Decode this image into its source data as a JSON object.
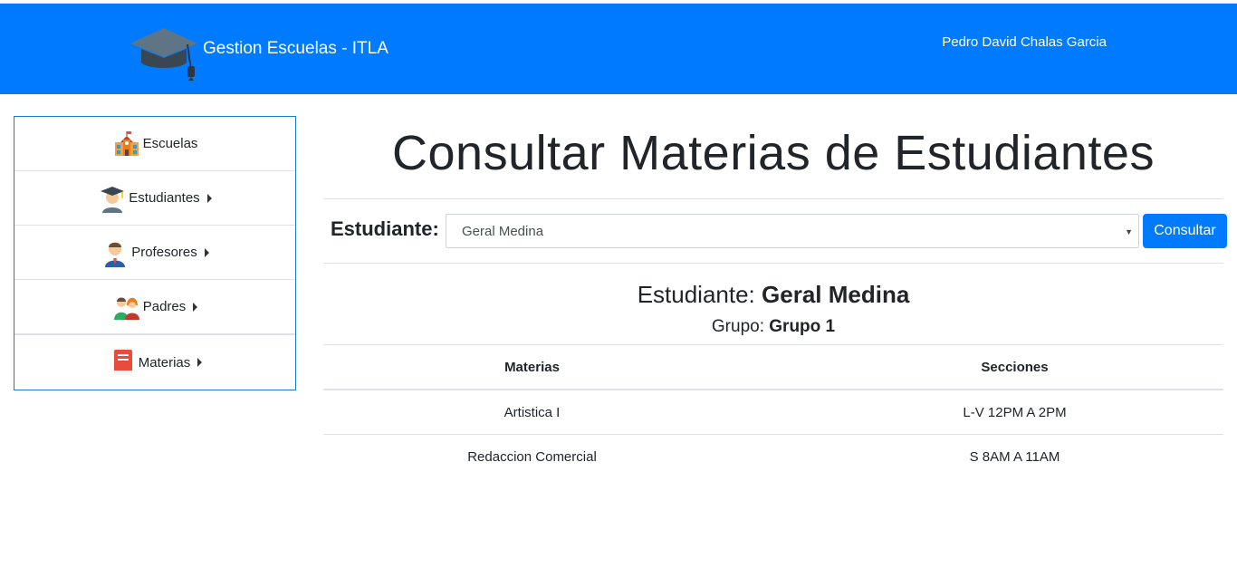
{
  "header": {
    "app_title": "Gestion Escuelas - ITLA",
    "user_name": "Pedro David Chalas Garcia",
    "logo_icon": "graduation-cap-icon",
    "background_color": "#007bff"
  },
  "sidebar": {
    "items": [
      {
        "label": "Escuelas",
        "icon": "school-building-icon",
        "has_submenu": false
      },
      {
        "label": "Estudiantes",
        "icon": "graduate-student-icon",
        "has_submenu": true
      },
      {
        "label": "Profesores",
        "icon": "teacher-icon",
        "has_submenu": true
      },
      {
        "label": "Padres",
        "icon": "parents-icon",
        "has_submenu": true
      },
      {
        "label": "Materias",
        "icon": "book-icon",
        "has_submenu": true
      }
    ]
  },
  "main": {
    "page_title": "Consultar Materias de Estudiantes",
    "form": {
      "label": "Estudiante:",
      "selected_student": "Geral Medina",
      "submit_label": "Consultar"
    },
    "result": {
      "student_label": "Estudiante:",
      "student_name": "Geral Medina",
      "group_label": "Grupo:",
      "group_name": "Grupo 1"
    },
    "table": {
      "headers": [
        "Materias",
        "Secciones"
      ],
      "rows": [
        [
          "Artistica I",
          "L-V 12PM A 2PM"
        ],
        [
          "Redaccion Comercial",
          "S 8AM A 11AM"
        ]
      ]
    }
  }
}
